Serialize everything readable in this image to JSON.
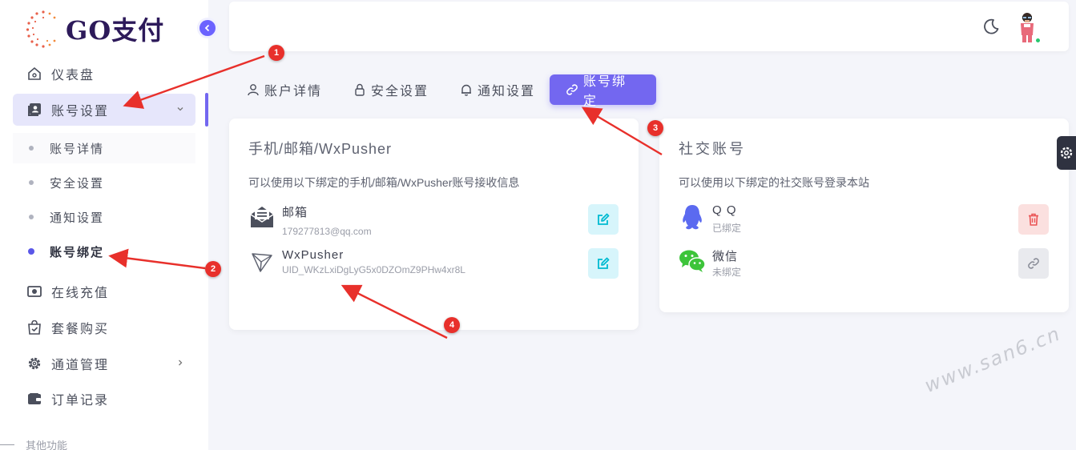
{
  "app": {
    "logo_text": "GO支付"
  },
  "sidebar": {
    "items": [
      {
        "label": "仪表盘",
        "icon": "home-icon"
      },
      {
        "label": "账号设置",
        "icon": "user-card-icon",
        "active": true,
        "expanded": true
      },
      {
        "label": "在线充值",
        "icon": "cash-icon"
      },
      {
        "label": "套餐购买",
        "icon": "shopping-bag-icon"
      },
      {
        "label": "通道管理",
        "icon": "gear-icon"
      },
      {
        "label": "订单记录",
        "icon": "wallet-icon"
      }
    ],
    "sub_items": [
      {
        "label": "账号详情"
      },
      {
        "label": "安全设置"
      },
      {
        "label": "通知设置"
      },
      {
        "label": "账号绑定",
        "active": true
      }
    ],
    "section_label": "其他功能"
  },
  "tabs": [
    {
      "label": "账户详情",
      "icon": "user-icon"
    },
    {
      "label": "安全设置",
      "icon": "lock-icon"
    },
    {
      "label": "通知设置",
      "icon": "bell-icon"
    },
    {
      "label": "账号绑定",
      "icon": "link-icon",
      "active": true
    }
  ],
  "contact_card": {
    "title": "手机/邮箱/WxPusher",
    "desc": "可以使用以下绑定的手机/邮箱/WxPusher账号接收信息",
    "rows": [
      {
        "name": "邮箱",
        "value": "179277813@qq.com",
        "icon": "mail-icon",
        "action": "edit-icon"
      },
      {
        "name": "WxPusher",
        "value": "UID_WKzLxiDgLyG5x0DZOmZ9PHw4xr8L",
        "icon": "paper-plane-icon",
        "action": "edit-icon"
      }
    ]
  },
  "social_card": {
    "title": "社交账号",
    "desc": "可以使用以下绑定的社交账号登录本站",
    "rows": [
      {
        "name": "Q Q",
        "status": "已绑定",
        "icon": "qq-icon",
        "action": "trash-icon"
      },
      {
        "name": "微信",
        "status": "未绑定",
        "icon": "wechat-icon",
        "action": "link-icon"
      }
    ]
  },
  "annotations": [
    "1",
    "2",
    "3",
    "4"
  ],
  "watermark": "www.san6.cn",
  "colors": {
    "primary": "#7367f0",
    "active_bg": "#e6e6fb",
    "edit_bg": "#d7f5fb",
    "edit_fg": "#00bad1",
    "delete_bg": "#fbe0df",
    "delete_fg": "#ea5455",
    "annotation_red": "#e8302b",
    "qq_blue": "#5b6af0",
    "wechat_green": "#3dc43a"
  }
}
